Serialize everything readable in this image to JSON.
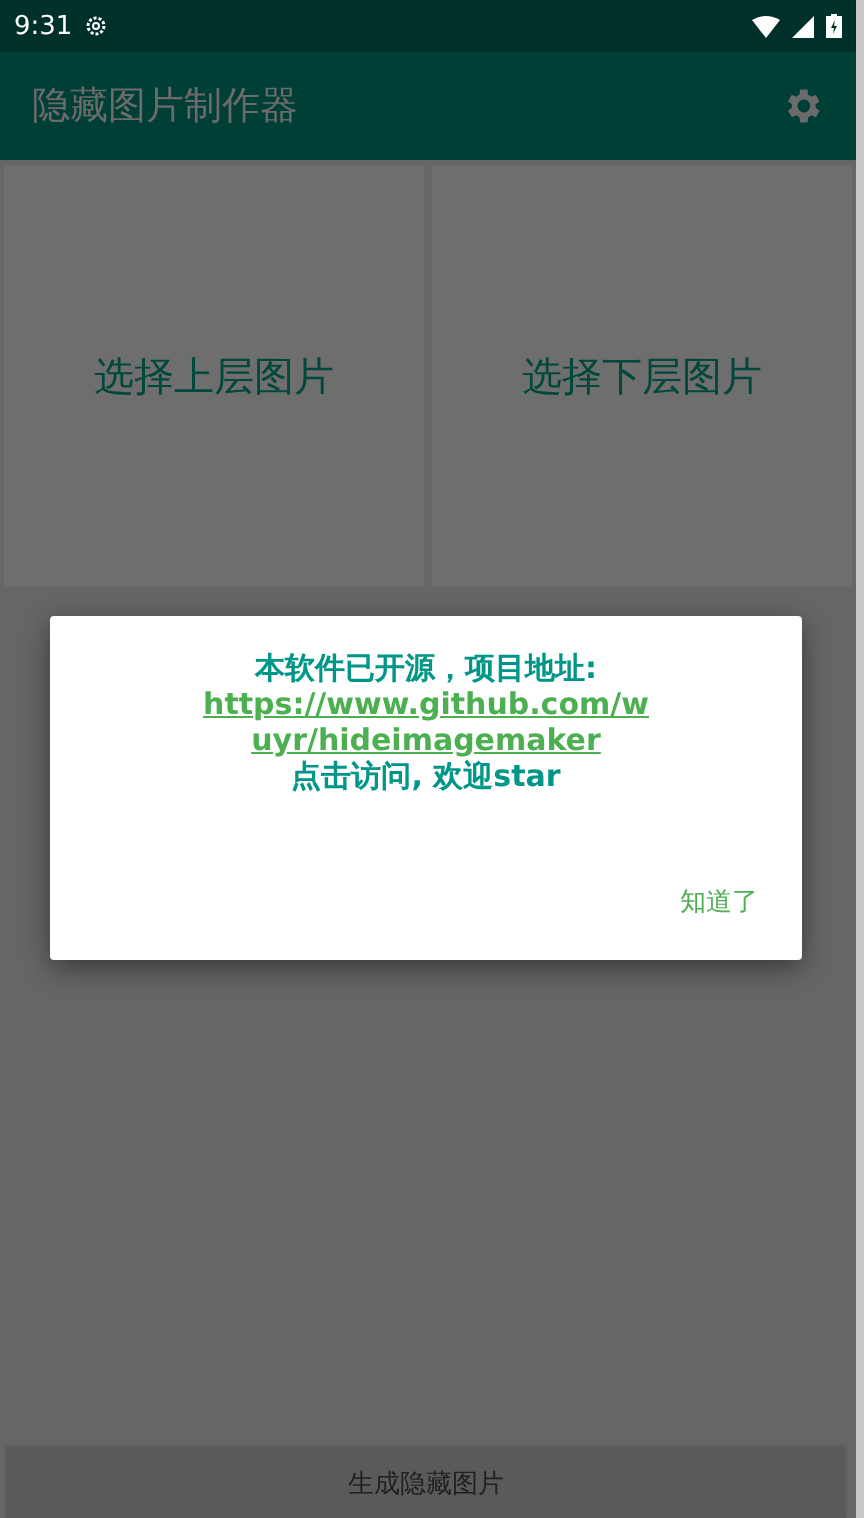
{
  "status_bar": {
    "time": "9:31"
  },
  "app_bar": {
    "title": "隐藏图片制作器"
  },
  "tiles": [
    {
      "label": "选择上层图片"
    },
    {
      "label": "选择下层图片"
    }
  ],
  "dialog": {
    "heading": "本软件已开源，项目地址:",
    "link": "https://www.github.com/wuyr/hideimagemaker",
    "note": "点击访问, 欢迎star",
    "button": "知道了"
  },
  "generate_button": "生成隐藏图片"
}
